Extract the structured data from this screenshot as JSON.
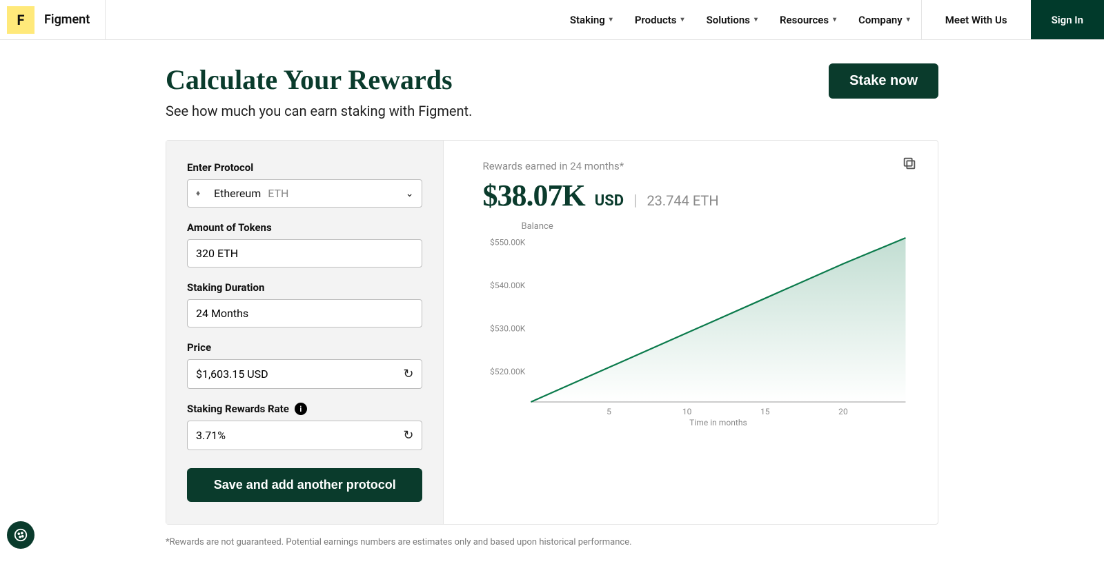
{
  "header": {
    "brand": "Figment",
    "nav": [
      "Staking",
      "Products",
      "Solutions",
      "Resources",
      "Company"
    ],
    "meet": "Meet With Us",
    "signin": "Sign In"
  },
  "hero": {
    "title": "Calculate Your Rewards",
    "subtitle": "See how much you can earn staking with Figment.",
    "cta": "Stake now"
  },
  "form": {
    "protocol_label": "Enter Protocol",
    "protocol_name": "Ethereum",
    "protocol_ticker": "ETH",
    "amount_label": "Amount of Tokens",
    "amount_value": "320 ETH",
    "duration_label": "Staking Duration",
    "duration_value": "24 Months",
    "price_label": "Price",
    "price_value": "$1,603.15 USD",
    "rate_label": "Staking Rewards Rate",
    "rate_value": "3.71%",
    "save_button": "Save and add another protocol"
  },
  "result": {
    "caption": "Rewards earned in 24 months*",
    "usd": "$38.07K",
    "currency": "USD",
    "token_amount": "23.744 ETH"
  },
  "disclaimer": "*Rewards are not guaranteed. Potential earnings numbers are estimates only and based upon historical performance.",
  "chart_data": {
    "type": "line",
    "title": "Balance",
    "xlabel": "Time in months",
    "ylabel": "",
    "y_ticks": [
      "$550.00K",
      "$540.00K",
      "$530.00K",
      "$520.00K"
    ],
    "x_ticks": [
      5,
      10,
      15,
      20
    ],
    "ylim": [
      513000,
      551000
    ],
    "xlim": [
      0,
      24
    ],
    "series": [
      {
        "name": "Balance",
        "x": [
          0,
          5,
          10,
          15,
          20,
          24
        ],
        "values": [
          513000,
          521000,
          529000,
          537000,
          545000,
          551000
        ]
      }
    ]
  }
}
